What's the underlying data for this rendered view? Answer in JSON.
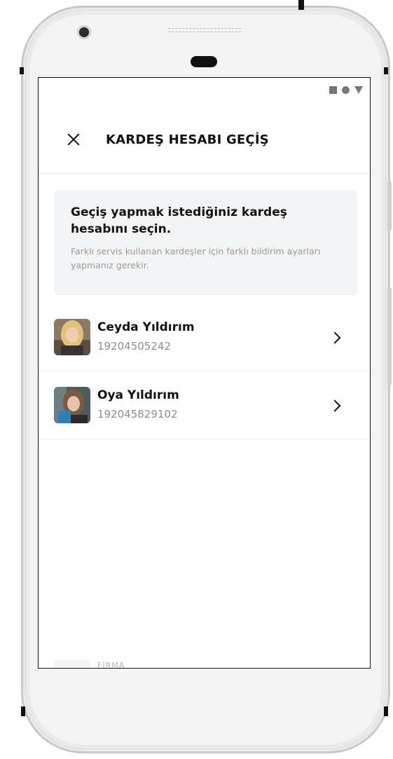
{
  "status_bar": {
    "icons": [
      "square-icon",
      "circle-icon",
      "triangle-icon"
    ]
  },
  "header": {
    "title": "KARDEŞ HESABI GEÇİŞ",
    "close_icon": "close-icon"
  },
  "info": {
    "title": "Geçiş yapmak istediğiniz kardeş hesabını seçin.",
    "description": "Farklı servis kullanan kardeşler için farklı bildirim ayarları yapmanız gerekir."
  },
  "accounts": [
    {
      "name": "Ceyda Yıldırım",
      "id": "19204505242"
    },
    {
      "name": "Oya Yıldırım",
      "id": "192045829102"
    }
  ],
  "partial_row": {
    "label": "FİRMA"
  },
  "colors": {
    "text": "#111111",
    "muted": "#9a9a9a",
    "info_bg": "#f2f4f5"
  }
}
